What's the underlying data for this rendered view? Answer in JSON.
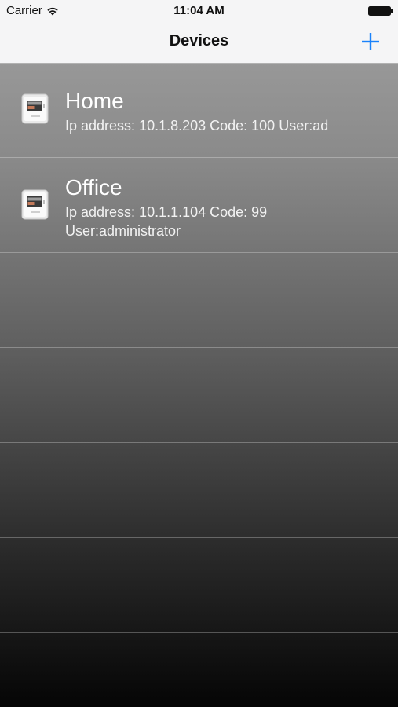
{
  "status_bar": {
    "carrier": "Carrier",
    "time": "11:04 AM",
    "wifi_icon": "wifi-icon",
    "battery_icon": "battery-full-icon"
  },
  "nav": {
    "title": "Devices",
    "add_icon": "plus-icon",
    "accent_color": "#1a82fb"
  },
  "devices": [
    {
      "name": "Home",
      "detail": "Ip address: 10.1.8.203 Code: 100 User:ad",
      "icon": "device-panel-icon"
    },
    {
      "name": "Office",
      "detail": "Ip address: 10.1.1.104 Code: 99 User:administrator",
      "icon": "device-panel-icon"
    }
  ],
  "empty_rows": 4
}
